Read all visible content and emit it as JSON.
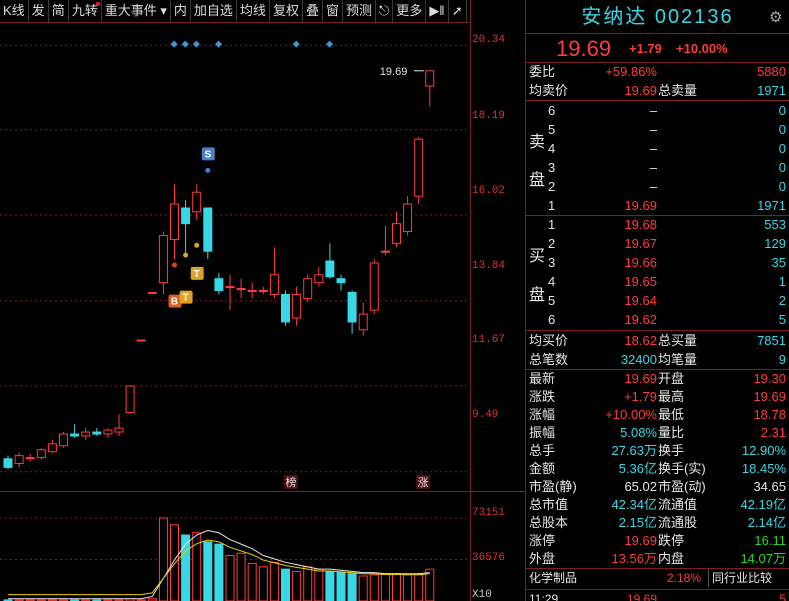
{
  "toolbar": {
    "items": [
      "K线",
      "发",
      "简",
      "九转",
      "重大事件",
      "内",
      "加自选",
      "均线",
      "复权",
      "叠",
      "窗",
      "预测",
      "更多"
    ]
  },
  "chart": {
    "price_axis": [
      "20.34",
      "18.19",
      "16.02",
      "13.84",
      "11.67",
      "9.49"
    ],
    "vol_axis": [
      "73151",
      "36576",
      "X10"
    ],
    "last_price_label": "19.69",
    "signals": {
      "s": "S",
      "b": "B",
      "t1": "T",
      "t2": "T"
    },
    "markers": {
      "bang": "榜",
      "zhang": "涨"
    }
  },
  "chart_data": {
    "type": "candlestick",
    "ylim": [
      9.0,
      20.6
    ],
    "candles": [
      {
        "o": 9.82,
        "c": 9.6,
        "h": 9.9,
        "l": 9.55
      },
      {
        "o": 9.7,
        "c": 9.9,
        "h": 9.98,
        "l": 9.6
      },
      {
        "o": 9.85,
        "c": 9.85,
        "h": 9.95,
        "l": 9.75
      },
      {
        "o": 9.85,
        "c": 10.05,
        "h": 10.1,
        "l": 9.8
      },
      {
        "o": 10.0,
        "c": 10.2,
        "h": 10.3,
        "l": 9.95
      },
      {
        "o": 10.15,
        "c": 10.45,
        "h": 10.5,
        "l": 10.1
      },
      {
        "o": 10.45,
        "c": 10.4,
        "h": 10.7,
        "l": 10.35
      },
      {
        "o": 10.4,
        "c": 10.5,
        "h": 10.6,
        "l": 10.3
      },
      {
        "o": 10.5,
        "c": 10.45,
        "h": 10.6,
        "l": 10.4
      },
      {
        "o": 10.45,
        "c": 10.55,
        "h": 10.6,
        "l": 10.35
      },
      {
        "o": 10.5,
        "c": 10.6,
        "h": 10.95,
        "l": 10.4
      },
      {
        "o": 11.0,
        "c": 11.67,
        "h": 11.7,
        "l": 10.95
      },
      {
        "o": 12.84,
        "c": 12.84,
        "h": 12.84,
        "l": 12.84
      },
      {
        "o": 14.05,
        "c": 14.05,
        "h": 14.05,
        "l": 14.05
      },
      {
        "o": 14.3,
        "c": 15.5,
        "h": 15.6,
        "l": 14.0
      },
      {
        "o": 15.4,
        "c": 16.3,
        "h": 16.8,
        "l": 14.9
      },
      {
        "o": 16.2,
        "c": 15.8,
        "h": 16.4,
        "l": 15.0
      },
      {
        "o": 16.1,
        "c": 16.6,
        "h": 16.8,
        "l": 15.9
      },
      {
        "o": 16.2,
        "c": 15.1,
        "h": 16.2,
        "l": 14.9
      },
      {
        "o": 14.4,
        "c": 14.1,
        "h": 14.55,
        "l": 14.0
      },
      {
        "o": 14.2,
        "c": 14.2,
        "h": 14.5,
        "l": 13.6
      },
      {
        "o": 14.15,
        "c": 14.15,
        "h": 14.4,
        "l": 13.9
      },
      {
        "o": 14.1,
        "c": 14.1,
        "h": 14.3,
        "l": 13.9
      },
      {
        "o": 14.1,
        "c": 14.1,
        "h": 14.2,
        "l": 14.0
      },
      {
        "o": 14.0,
        "c": 14.5,
        "h": 15.2,
        "l": 13.9
      },
      {
        "o": 14.0,
        "c": 13.3,
        "h": 14.1,
        "l": 13.2
      },
      {
        "o": 13.4,
        "c": 14.0,
        "h": 14.2,
        "l": 13.2
      },
      {
        "o": 13.9,
        "c": 14.4,
        "h": 14.5,
        "l": 13.8
      },
      {
        "o": 14.3,
        "c": 14.5,
        "h": 14.7,
        "l": 14.2
      },
      {
        "o": 14.85,
        "c": 14.45,
        "h": 15.3,
        "l": 14.4
      },
      {
        "o": 14.4,
        "c": 14.3,
        "h": 14.5,
        "l": 14.1
      },
      {
        "o": 14.05,
        "c": 13.3,
        "h": 14.1,
        "l": 13.0
      },
      {
        "o": 13.1,
        "c": 13.5,
        "h": 13.8,
        "l": 12.95
      },
      {
        "o": 13.6,
        "c": 14.8,
        "h": 14.9,
        "l": 13.5
      },
      {
        "o": 15.1,
        "c": 15.1,
        "h": 15.75,
        "l": 15.0
      },
      {
        "o": 15.3,
        "c": 15.8,
        "h": 16.1,
        "l": 15.2
      },
      {
        "o": 15.6,
        "c": 16.3,
        "h": 16.5,
        "l": 15.5
      },
      {
        "o": 16.5,
        "c": 17.95,
        "h": 18.0,
        "l": 16.3
      },
      {
        "o": 19.3,
        "c": 19.69,
        "h": 19.69,
        "l": 18.78
      }
    ],
    "volumes": [
      1,
      1,
      1,
      1,
      1,
      1,
      1,
      1,
      1,
      1,
      1,
      2,
      1,
      2,
      73,
      67,
      58,
      60,
      52,
      50,
      40,
      42,
      33,
      30,
      34,
      28,
      26,
      30,
      28,
      26,
      25,
      24,
      22,
      23,
      24,
      24,
      23,
      23,
      28
    ],
    "volume_ma": [
      2,
      2,
      2,
      2,
      2,
      2,
      2,
      2,
      2,
      2,
      2,
      2,
      2,
      4,
      20,
      36,
      50,
      58,
      62,
      60,
      54,
      50,
      46,
      40,
      37,
      34,
      32,
      30,
      28,
      28,
      27,
      26,
      25,
      25,
      24,
      24,
      24,
      24,
      25
    ]
  },
  "panel": {
    "title": "安纳达",
    "code": "002136",
    "price": "19.69",
    "change": "+1.79",
    "change_pct": "+10.00%",
    "weibi_label": "委比",
    "weibi_pct": "+59.86%",
    "weibi_val": "5880",
    "junmai_label": "均卖价",
    "junmai_val": "19.69",
    "zongmai_label": "总卖量",
    "zongmai_val": "1971",
    "sell_side_label": [
      "卖",
      "盘"
    ],
    "sell": [
      {
        "lvl": "6",
        "price": "–",
        "vol": "0"
      },
      {
        "lvl": "5",
        "price": "–",
        "vol": "0"
      },
      {
        "lvl": "4",
        "price": "–",
        "vol": "0"
      },
      {
        "lvl": "3",
        "price": "–",
        "vol": "0"
      },
      {
        "lvl": "2",
        "price": "–",
        "vol": "0"
      },
      {
        "lvl": "1",
        "price": "19.69",
        "vol": "1971"
      }
    ],
    "buy_side_label": [
      "买",
      "盘"
    ],
    "buy": [
      {
        "lvl": "1",
        "price": "19.68",
        "vol": "553"
      },
      {
        "lvl": "2",
        "price": "19.67",
        "vol": "129"
      },
      {
        "lvl": "3",
        "price": "19.66",
        "vol": "35"
      },
      {
        "lvl": "4",
        "price": "19.65",
        "vol": "1"
      },
      {
        "lvl": "5",
        "price": "19.64",
        "vol": "2"
      },
      {
        "lvl": "6",
        "price": "19.62",
        "vol": "5"
      }
    ],
    "junmai2_label": "均买价",
    "junmai2_val": "18.62",
    "zongmai2_label": "总买量",
    "zongmai2_val": "7851",
    "zongbi_label": "总笔数",
    "zongbi_val": "32400",
    "junbi_label": "均笔量",
    "junbi_val": "9",
    "stats": [
      {
        "l1": "最新",
        "v1": "19.69",
        "c1": "red",
        "l2": "开盘",
        "v2": "19.30",
        "c2": "red"
      },
      {
        "l1": "涨跌",
        "v1": "+1.79",
        "c1": "red",
        "l2": "最高",
        "v2": "19.69",
        "c2": "red"
      },
      {
        "l1": "涨幅",
        "v1": "+10.00%",
        "c1": "red",
        "l2": "最低",
        "v2": "18.78",
        "c2": "red"
      },
      {
        "l1": "振幅",
        "v1": "5.08%",
        "c1": "cyan",
        "l2": "量比",
        "v2": "2.31",
        "c2": "red"
      },
      {
        "l1": "总手",
        "v1": "27.63万",
        "c1": "cyan",
        "l2": "换手",
        "v2": "12.90%",
        "c2": "cyan"
      },
      {
        "l1": "金额",
        "v1": "5.36亿",
        "c1": "cyan",
        "l2": "换手(实)",
        "v2": "18.45%",
        "c2": "cyan"
      },
      {
        "l1": "市盈(静)",
        "v1": "65.02",
        "c1": "white",
        "l2": "市盈(动)",
        "v2": "34.65",
        "c2": "white"
      },
      {
        "l1": "总市值",
        "v1": "42.34亿",
        "c1": "cyan",
        "l2": "流通值",
        "v2": "42.19亿",
        "c2": "cyan"
      },
      {
        "l1": "总股本",
        "v1": "2.15亿",
        "c1": "cyan",
        "l2": "流通股",
        "v2": "2.14亿",
        "c2": "cyan"
      },
      {
        "l1": "涨停",
        "v1": "19.69",
        "c1": "red",
        "l2": "跌停",
        "v2": "16.11",
        "c2": "green"
      },
      {
        "l1": "外盘",
        "v1": "13.56万",
        "c1": "red",
        "l2": "内盘",
        "v2": "14.07万",
        "c2": "green"
      }
    ],
    "industry": "化学制品",
    "industry_pct": "2.18%",
    "industry_btn": "同行业比较",
    "bottom_time": "11:29",
    "bottom_price": "19.69",
    "bottom_vol": "5"
  },
  "colors": {
    "up": "#ff3b3b",
    "down": "#39d7e6",
    "grid": "#7a1f1f",
    "accent": "#39d7e6"
  }
}
